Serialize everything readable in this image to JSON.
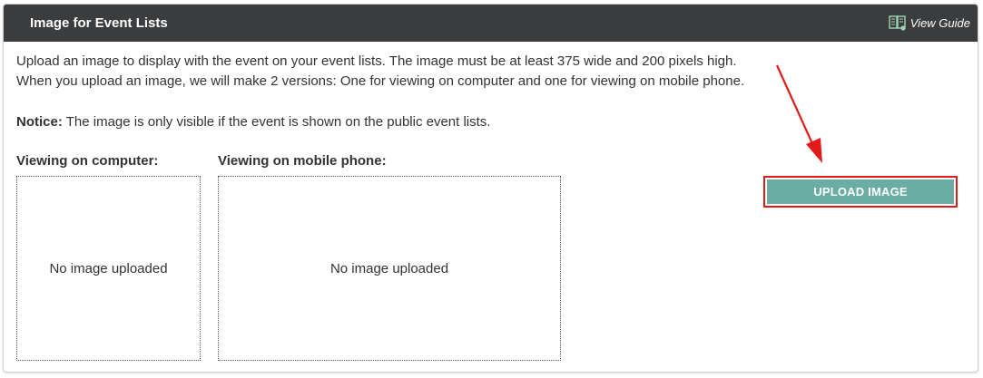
{
  "panel": {
    "title": "Image for Event Lists",
    "guide_link": "View Guide",
    "guide_icon": "book-icon"
  },
  "description": {
    "line1": "Upload an image to display with the event on your event lists. The image must be at least 375 wide and 200 pixels high.",
    "line2": "When you upload an image, we will make 2 versions: One for viewing on computer and one for viewing on mobile phone."
  },
  "notice": {
    "label": "Notice:",
    "text": " The image is only visible if the event is shown on the public event lists."
  },
  "computer": {
    "label": "Viewing on computer:",
    "placeholder": "No image uploaded"
  },
  "mobile": {
    "label": "Viewing on mobile phone:",
    "placeholder": "No image uploaded"
  },
  "upload": {
    "label": "UPLOAD IMAGE"
  },
  "colors": {
    "header_bg": "#3b3c3e",
    "button_bg": "#6aada4",
    "highlight": "#e21a1a"
  }
}
